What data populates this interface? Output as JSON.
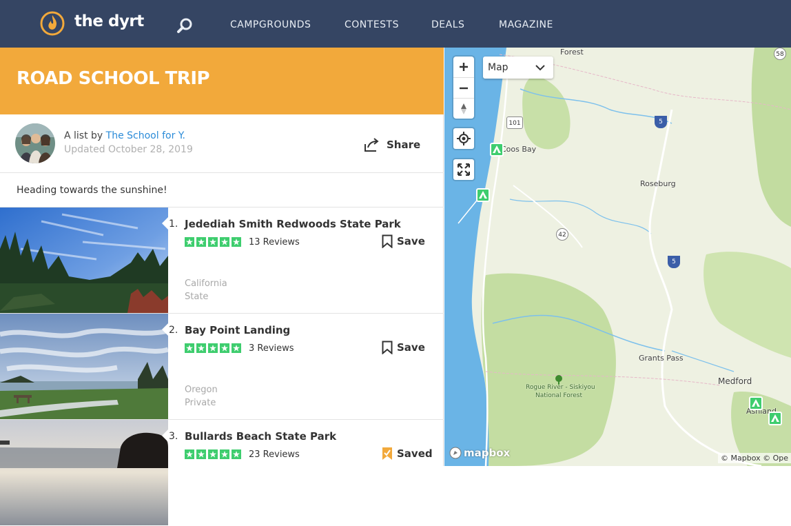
{
  "header": {
    "brand": "the dyrt",
    "nav": [
      "CAMPGROUNDS",
      "CONTESTS",
      "DEALS",
      "MAGAZINE"
    ]
  },
  "list": {
    "title": "ROAD SCHOOL TRIP",
    "by_prefix": "A list by",
    "author": "The School for Y.",
    "updated": "Updated October 28, 2019",
    "share_label": "Share",
    "description": "Heading towards the sunshine!"
  },
  "campgrounds": [
    {
      "number": "1.",
      "name": "Jedediah Smith Redwoods State Park",
      "rating": 5,
      "reviews": "13 Reviews",
      "save_label": "Save",
      "saved": false,
      "state": "California",
      "owner": "State"
    },
    {
      "number": "2.",
      "name": "Bay Point Landing",
      "rating": 5,
      "reviews": "3 Reviews",
      "save_label": "Save",
      "saved": false,
      "state": "Oregon",
      "owner": "Private"
    },
    {
      "number": "3.",
      "name": "Bullards Beach State Park",
      "rating": 5,
      "reviews": "23 Reviews",
      "save_label": "Saved",
      "saved": true,
      "state": "",
      "owner": ""
    }
  ],
  "map": {
    "type_select": "Map",
    "labels": {
      "forest": "Forest",
      "coos_bay": "Coos Bay",
      "roseburg": "Roseburg",
      "grants_pass": "Grants Pass",
      "medford": "Medford",
      "ashland": "Ashland",
      "rogue_line1": "Rogue River - Siskiyou",
      "rogue_line2": "National Forest"
    },
    "shields": {
      "us101": "101",
      "i5_a": "5",
      "i5_b": "5",
      "or42": "42",
      "r58": "58"
    },
    "mapbox": "mapbox",
    "attribution": "© Mapbox © Ope"
  },
  "colors": {
    "header_bg": "#354563",
    "banner": "#f2a93b",
    "link": "#2a8bd8",
    "star_green": "#3ecd6e",
    "saved_orange": "#f2a93b"
  }
}
